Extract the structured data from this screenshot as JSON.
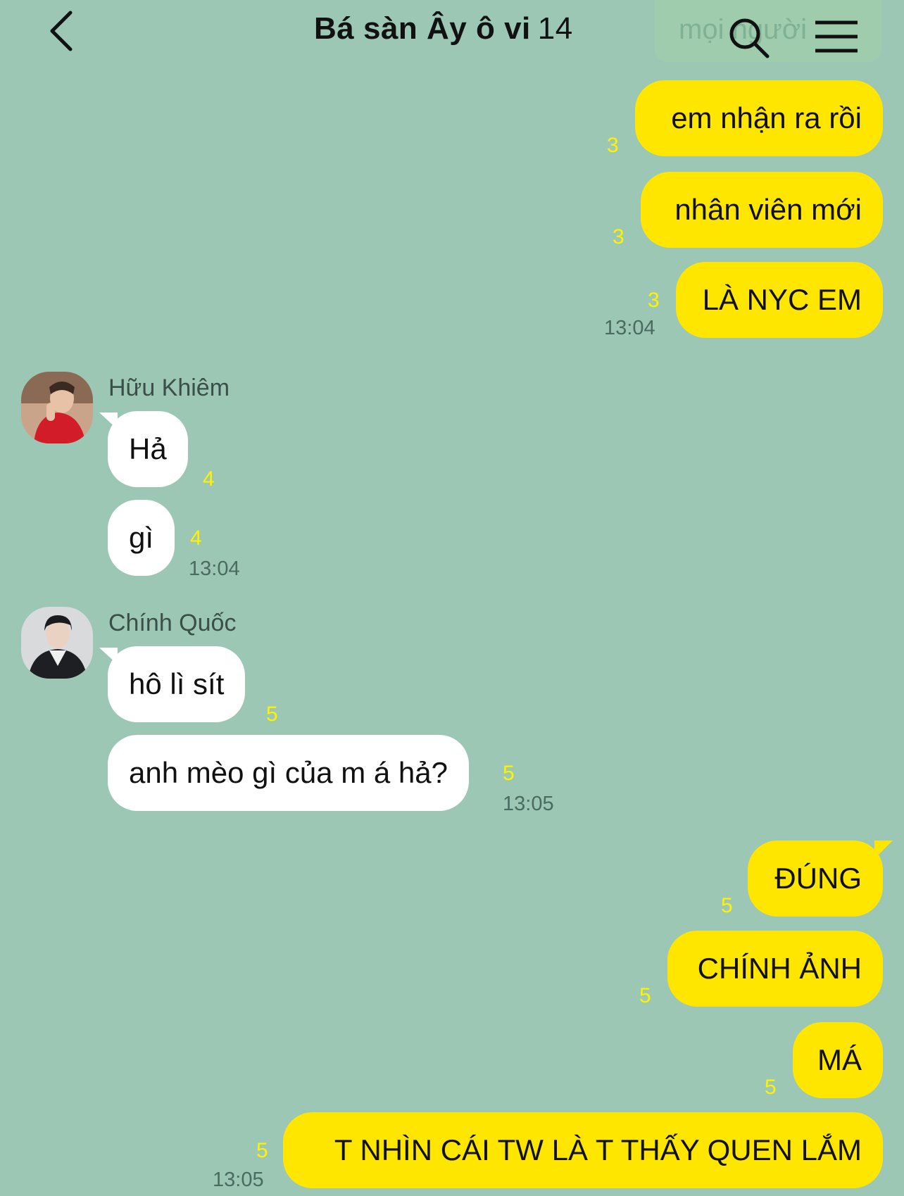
{
  "header": {
    "title": "Bá sàn Ây ô vi",
    "member_count": "14",
    "ghost_text": "mọi người"
  },
  "colors": {
    "background": "#9dc7b5",
    "my_bubble": "#ffe600",
    "their_bubble": "#ffffff",
    "read_count": "#fff200"
  },
  "messages": {
    "m1": {
      "text": "em nhận ra rồi",
      "read": "3"
    },
    "m2": {
      "text": "nhân viên mới",
      "read": "3"
    },
    "m3": {
      "text": "LÀ NYC EM",
      "read": "3",
      "time": "13:04"
    },
    "group1": {
      "sender": "Hữu Khiêm"
    },
    "m4": {
      "text": "Hả",
      "read": "4"
    },
    "m5": {
      "text": "gì",
      "read": "4",
      "time": "13:04"
    },
    "group2": {
      "sender": "Chính Quốc"
    },
    "m6": {
      "text": "hô lì sít",
      "read": "5"
    },
    "m7": {
      "text": "anh mèo gì của m á hả?",
      "read": "5",
      "time": "13:05"
    },
    "m8": {
      "text": "ĐÚNG",
      "read": "5"
    },
    "m9": {
      "text": "CHÍNH ẢNH",
      "read": "5"
    },
    "m10": {
      "text": "MÁ",
      "read": "5"
    },
    "m11": {
      "text": "T NHÌN CÁI TW LÀ T THẤY QUEN LẮM",
      "read": "5",
      "time": "13:05"
    }
  }
}
